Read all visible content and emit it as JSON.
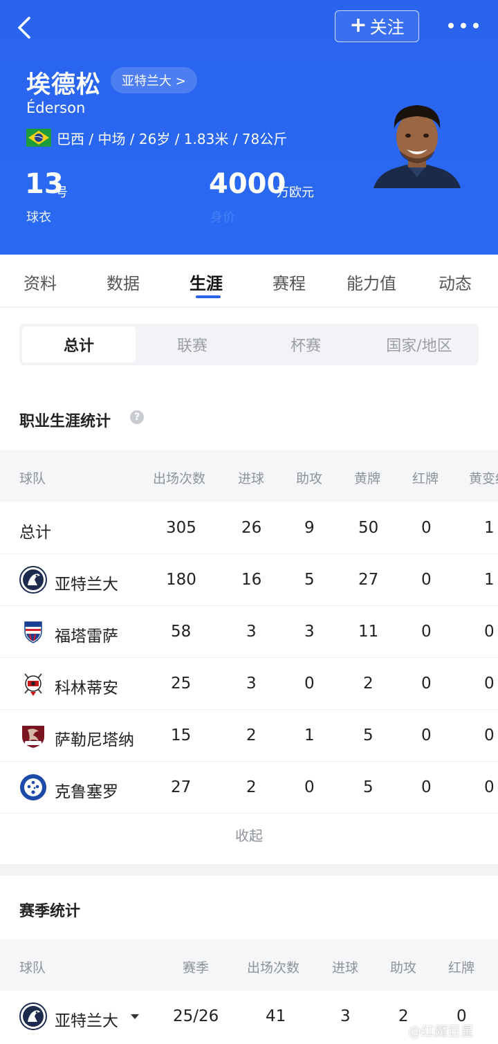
{
  "header": {
    "follow_label": "关注",
    "player_name": "埃德松",
    "club_pill": "亚特兰大 >",
    "player_name_en": "Éderson",
    "info": "巴西 / 中场 / 26岁 / 1.83米 / 78公斤",
    "shirt_number": "13",
    "shirt_unit": "号",
    "shirt_label": "球衣",
    "market_value": "4000",
    "market_value_unit": "万欧元",
    "market_value_label": "身价"
  },
  "tabs": [
    "资料",
    "数据",
    "生涯",
    "赛程",
    "能力值",
    "动态"
  ],
  "active_tab": "生涯",
  "segments": [
    "总计",
    "联赛",
    "杯赛",
    "国家/地区"
  ],
  "active_segment": "总计",
  "career": {
    "title": "职业生涯统计",
    "columns": [
      "球队",
      "出场次数",
      "进球",
      "助攻",
      "黄牌",
      "红牌",
      "黄变红"
    ],
    "rows": [
      {
        "team": "总计",
        "apps": "305",
        "goals": "26",
        "assists": "9",
        "yellow": "50",
        "red": "0",
        "second_yellow": "1"
      },
      {
        "team": "亚特兰大",
        "apps": "180",
        "goals": "16",
        "assists": "5",
        "yellow": "27",
        "red": "0",
        "second_yellow": "1"
      },
      {
        "team": "福塔雷萨",
        "apps": "58",
        "goals": "3",
        "assists": "3",
        "yellow": "11",
        "red": "0",
        "second_yellow": "0"
      },
      {
        "team": "科林蒂安",
        "apps": "25",
        "goals": "3",
        "assists": "0",
        "yellow": "2",
        "red": "0",
        "second_yellow": "0"
      },
      {
        "team": "萨勒尼塔纳",
        "apps": "15",
        "goals": "2",
        "assists": "1",
        "yellow": "5",
        "red": "0",
        "second_yellow": "0"
      },
      {
        "team": "克鲁塞罗",
        "apps": "27",
        "goals": "2",
        "assists": "0",
        "yellow": "5",
        "red": "0",
        "second_yellow": "0"
      }
    ],
    "collapse_label": "收起"
  },
  "season": {
    "title": "赛季统计",
    "columns": [
      "球队",
      "赛季",
      "出场次数",
      "进球",
      "助攻",
      "红牌"
    ],
    "rows": [
      {
        "team": "亚特兰大",
        "season": "25/26",
        "apps": "41",
        "goals": "3",
        "assists": "2",
        "red": "0"
      }
    ]
  },
  "watermark": "@红魔巨星",
  "colors": {
    "brand_blue": "#2a63ee",
    "brazil_green": "#1e9c3c",
    "brazil_yellow": "#f7d117"
  }
}
